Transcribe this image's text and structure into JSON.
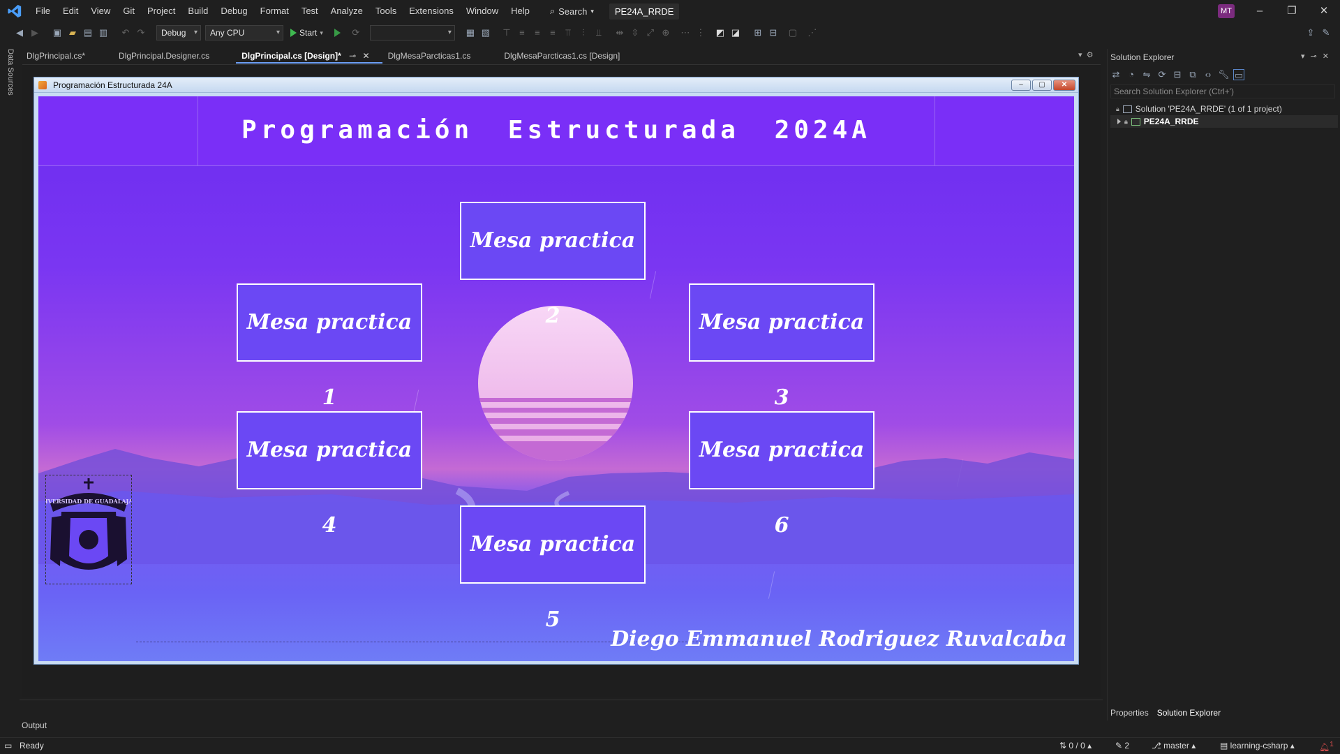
{
  "menubar": {
    "items": [
      "File",
      "Edit",
      "View",
      "Git",
      "Project",
      "Build",
      "Debug",
      "Format",
      "Test",
      "Analyze",
      "Tools",
      "Extensions",
      "Window",
      "Help"
    ],
    "search_label": "Search",
    "project_name": "PE24A_RRDE",
    "user_initials": "MT"
  },
  "toolbar": {
    "config": "Debug",
    "platform": "Any CPU",
    "start_label": "Start"
  },
  "side_panel_label": "Data Sources",
  "tabs": [
    {
      "label": "DlgPrincipal.cs*"
    },
    {
      "label": "DlgPrincipal.Designer.cs"
    },
    {
      "label": "DlgPrincipal.cs [Design]*"
    },
    {
      "label": "DlgMesaParcticas1.cs"
    },
    {
      "label": "DlgMesaParcticas1.cs [Design]"
    }
  ],
  "form": {
    "window_title": "Programación Estructurada 24A",
    "heading": "Programación  Estructurada  2024A",
    "buttons": {
      "mp1": "Mesa practica 1",
      "mp2": "Mesa practica 2",
      "mp3": "Mesa practica 3",
      "mp4": "Mesa practica 4",
      "mp5": "Mesa practica 5",
      "mp6": "Mesa practica 6"
    },
    "logo_text": "UNIVERSIDAD DE GUADALAJARA",
    "author": "Diego Emmanuel Rodriguez Ruvalcaba"
  },
  "output_label": "Output",
  "solution_explorer": {
    "title": "Solution Explorer",
    "search_placeholder": "Search Solution Explorer (Ctrl+')",
    "solution_row": "Solution 'PE24A_RRDE' (1 of 1 project)",
    "project_row": "PE24A_RRDE",
    "bottom_tabs": [
      "Properties",
      "Solution Explorer"
    ]
  },
  "statusbar": {
    "ready": "Ready",
    "changes": "0 / 0",
    "pencil_count": "2",
    "branch": "master",
    "repo": "learning-csharp",
    "notifications": "1"
  },
  "colors": {
    "accent": "#7a2ff7",
    "button_fill": "#6b48f4",
    "chrome": "#1f1f1f"
  }
}
